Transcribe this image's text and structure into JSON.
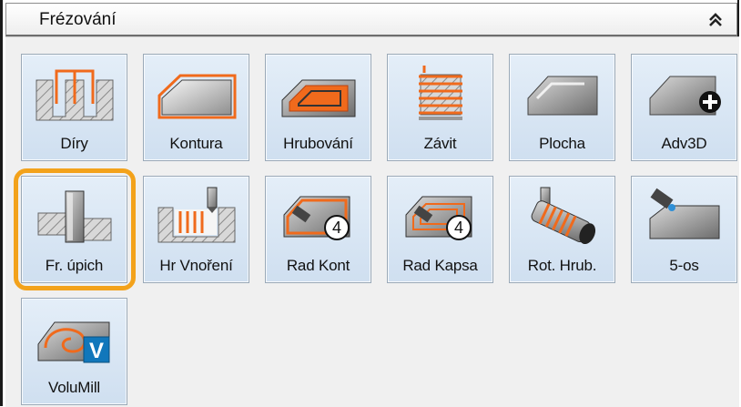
{
  "panel": {
    "title": "Frézování",
    "collapse_icon": "double-chevron-up-icon",
    "accent_highlight": "#f3a21b",
    "tiles": [
      {
        "label": "Díry",
        "icon": "drill-holes-icon"
      },
      {
        "label": "Kontura",
        "icon": "contour-icon"
      },
      {
        "label": "Hrubování",
        "icon": "roughing-icon"
      },
      {
        "label": "Závit",
        "icon": "thread-icon"
      },
      {
        "label": "Plocha",
        "icon": "face-icon"
      },
      {
        "label": "Adv3D",
        "icon": "adv3d-icon"
      },
      {
        "label": "Fr. úpich",
        "icon": "slot-mill-icon",
        "selected": true
      },
      {
        "label": "Hr Vnoření",
        "icon": "plunge-rough-icon"
      },
      {
        "label": "Rad Kont",
        "icon": "radial-contour-icon"
      },
      {
        "label": "Rad Kapsa",
        "icon": "radial-pocket-icon"
      },
      {
        "label": "Rot. Hrub.",
        "icon": "rotary-rough-icon"
      },
      {
        "label": "5-os",
        "icon": "five-axis-icon"
      },
      {
        "label": "VoluMill",
        "icon": "volumill-icon"
      }
    ]
  }
}
